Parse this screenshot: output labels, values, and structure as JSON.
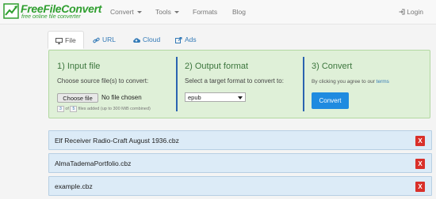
{
  "brand": {
    "title": "FreeFileConvert",
    "tagline": "free online file converter"
  },
  "nav": {
    "items": [
      "Convert",
      "Tools",
      "Formats",
      "Blog"
    ],
    "login": "Login"
  },
  "tabs": [
    {
      "label": "File",
      "icon": "monitor-icon",
      "active": true
    },
    {
      "label": "URL",
      "icon": "link-icon",
      "active": false
    },
    {
      "label": "Cloud",
      "icon": "cloud-icon",
      "active": false
    },
    {
      "label": "Ads",
      "icon": "external-link-icon",
      "active": false
    }
  ],
  "input": {
    "title": "1) Input file",
    "subtitle": "Choose source file(s) to convert:",
    "choose_button": "Choose file",
    "no_file": "No file chosen",
    "count_current": "3",
    "count_of": "of",
    "count_max": "5",
    "count_suffix": "files added (up to 300 MiB combined)"
  },
  "output": {
    "title": "2) Output format",
    "subtitle": "Select a target format to convert to:",
    "selected_format": "epub"
  },
  "convert": {
    "title": "3) Convert",
    "agree_text": "By clicking you agree to our",
    "terms_link": "terms",
    "button": "Convert"
  },
  "files": [
    {
      "name": "Elf Receiver Radio-Craft August 1936.cbz",
      "remove": "X"
    },
    {
      "name": "AlmaTademaPortfolio.cbz",
      "remove": "X"
    },
    {
      "name": "example.cbz",
      "remove": "X"
    }
  ],
  "colors": {
    "panel_bg": "#dff0d8",
    "heading_green": "#3c763d",
    "primary_blue": "#1f8be0",
    "link_blue": "#337ab7",
    "danger_red": "#d9302a",
    "file_row_bg": "#dcebf7"
  }
}
